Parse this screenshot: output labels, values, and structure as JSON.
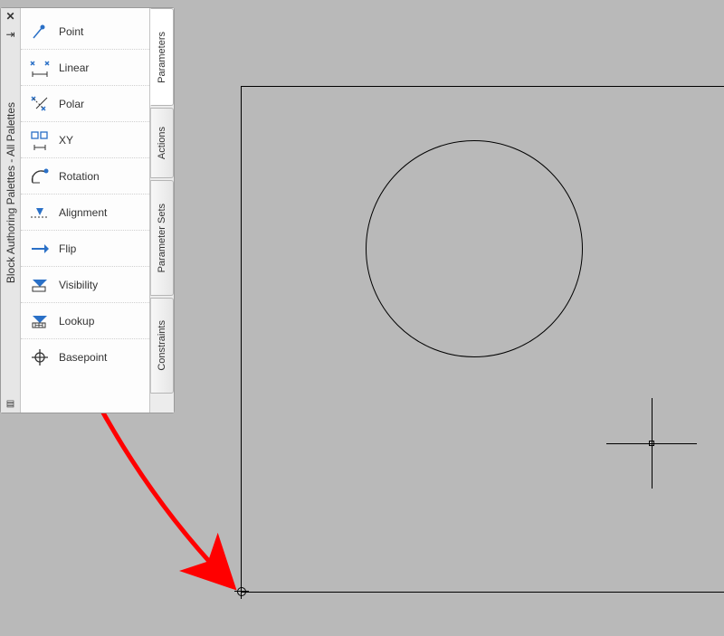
{
  "palette_title": "Block Authoring Palettes - All Palettes",
  "tabs": [
    {
      "label": "Parameters"
    },
    {
      "label": "Actions"
    },
    {
      "label": "Parameter Sets"
    },
    {
      "label": "Constraints"
    }
  ],
  "tools": [
    {
      "label": "Point",
      "icon": "point-icon"
    },
    {
      "label": "Linear",
      "icon": "linear-icon"
    },
    {
      "label": "Polar",
      "icon": "polar-icon"
    },
    {
      "label": "XY",
      "icon": "xy-icon"
    },
    {
      "label": "Rotation",
      "icon": "rotation-icon"
    },
    {
      "label": "Alignment",
      "icon": "alignment-icon"
    },
    {
      "label": "Flip",
      "icon": "flip-icon"
    },
    {
      "label": "Visibility",
      "icon": "visibility-icon"
    },
    {
      "label": "Lookup",
      "icon": "lookup-icon"
    },
    {
      "label": "Basepoint",
      "icon": "basepoint-icon"
    }
  ],
  "annotation": {
    "arrow_color": "#ff0000"
  }
}
